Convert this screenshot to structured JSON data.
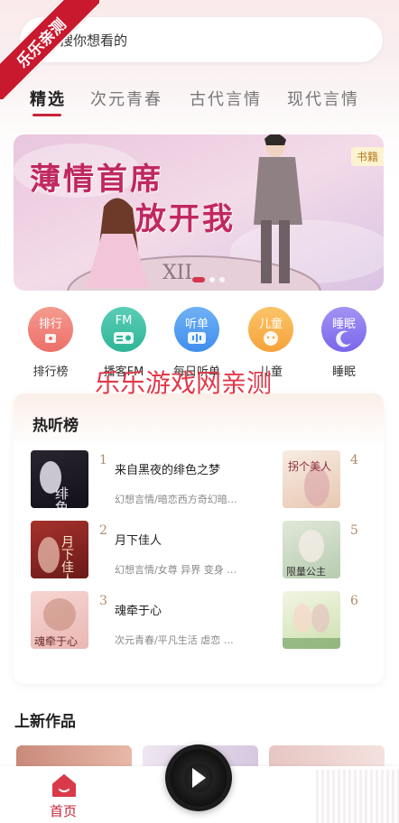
{
  "corner_ribbon": "乐乐亲测",
  "search": {
    "placeholder": "搜你想看的"
  },
  "tabs": [
    {
      "label": "精选"
    },
    {
      "label": "次元青春"
    },
    {
      "label": "古代言情"
    },
    {
      "label": "现代言情"
    }
  ],
  "banner": {
    "line1": "薄情首席",
    "line2": "放开我",
    "badge": "书籍",
    "dots": 3,
    "active_dot": 1
  },
  "categories": [
    {
      "badge": "排行",
      "label": "排行榜",
      "color": "#f07e74",
      "icon": "trophy-icon"
    },
    {
      "badge": "FM",
      "label": "播客FM",
      "color": "#3fc0a6",
      "icon": "radio-icon"
    },
    {
      "badge": "听单",
      "label": "每日听单",
      "color": "#4a9cf0",
      "icon": "audio-wave-icon"
    },
    {
      "badge": "儿童",
      "label": "儿童",
      "color": "#f9b248",
      "icon": "child-face-icon"
    },
    {
      "badge": "睡眠",
      "label": "睡眠",
      "color": "#8a78f0",
      "icon": "moon-icon"
    }
  ],
  "watermark": "乐乐游戏网亲测",
  "hot": {
    "title": "热听榜",
    "books": [
      {
        "rank": "1",
        "title": "来自黑夜的绯色之梦",
        "sub": "幻想言情/暗恋西方奇幻暗…",
        "cover_text": "绯色之梦"
      },
      {
        "rank": "2",
        "title": "月下佳人",
        "sub": "幻想言情/女尊 异界 变身 …",
        "cover_text": "月下佳人"
      },
      {
        "rank": "3",
        "title": "魂牵于心",
        "sub": "次元青春/平凡生活 虐恋 …",
        "cover_text": "魂牵于心"
      },
      {
        "rank": "4",
        "title": "",
        "sub": "",
        "cover_text": "拐个美人下山"
      },
      {
        "rank": "5",
        "title": "",
        "sub": "",
        "cover_text": "限量公主"
      },
      {
        "rank": "6",
        "title": "",
        "sub": "",
        "cover_text": ""
      }
    ]
  },
  "new_works": {
    "title": "上新作品"
  },
  "nav": {
    "home": "首页"
  },
  "colors": {
    "accent": "#c8243a"
  }
}
